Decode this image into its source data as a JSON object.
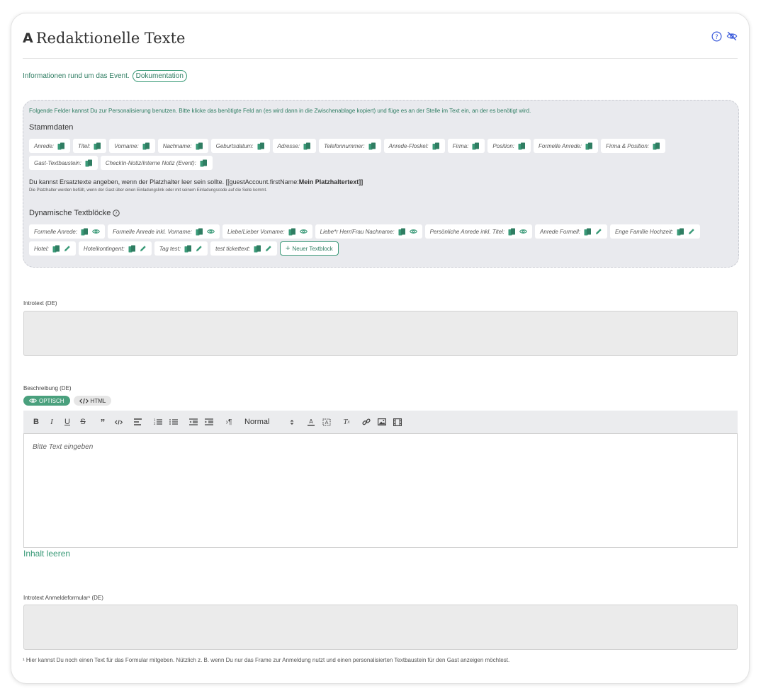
{
  "header": {
    "title": "Redaktionelle Texte",
    "title_glyph": "A"
  },
  "info": {
    "text": "Informationen rund um das Event.",
    "doc_link": "Dokumentation"
  },
  "fields": {
    "intro": "Folgende Felder kannst Du zur Personalisierung benutzen. Bitte klicke das benötigte Feld an (es wird dann in die Zwischenablage kopiert) und füge es an der Stelle im Text ein, an der es benötigt wird.",
    "stammdaten_title": "Stammdaten",
    "stammdaten": [
      "Anrede:",
      "Titel:",
      "Vorname:",
      "Nachname:",
      "Geburtsdatum:",
      "Adresse:",
      "Telefonnummer:",
      "Anrede-Floskel:",
      "Firma:",
      "Position:",
      "Formelle Anrede:",
      "Firma & Position:",
      "Gast-Textbaustein:",
      "CheckIn-Notiz/Interne Notiz (Event):"
    ],
    "ersatz_text": "Du kannst Ersatztexte angeben, wenn der Platzhalter leer sein sollte. [[guestAccount.firstName:",
    "ersatz_bold": "Mein Platzhaltertext",
    "ersatz_end": "]]",
    "ersatz_note": "Die Platzhalter werden befüllt, wenn der Gast über einen Einladungslink oder mit seinem Einladungscode auf die Seite kommt.",
    "dynamic_title": "Dynamische Textblöcke",
    "dynamic": [
      {
        "label": "Formelle Anrede:",
        "action": "eye"
      },
      {
        "label": "Formelle Anrede inkl. Vorname:",
        "action": "eye"
      },
      {
        "label": "Liebe/Lieber Vorname:",
        "action": "eye"
      },
      {
        "label": "Liebe*r Herr/Frau Nachname:",
        "action": "eye"
      },
      {
        "label": "Persönliche Anrede inkl. Titel:",
        "action": "eye"
      },
      {
        "label": "Anrede Formell:",
        "action": "pencil"
      },
      {
        "label": "Enge Familie Hochzeit:",
        "action": "pencil"
      },
      {
        "label": "Hotel:",
        "action": "pencil"
      },
      {
        "label": "Hotelkontingent:",
        "action": "pencil"
      },
      {
        "label": "Tag test:",
        "action": "pencil"
      },
      {
        "label": "test tickettext:",
        "action": "pencil"
      }
    ],
    "new_block": "Neuer Textblock"
  },
  "introtext": {
    "label": "Introtext (DE)",
    "value": ""
  },
  "beschreibung": {
    "label": "Beschreibung (DE)",
    "mode_visual": "OPTISCH",
    "mode_html": "HTML",
    "heading_select": "Normal",
    "placeholder": "Bitte Text eingeben",
    "clear_label": "Inhalt leeren"
  },
  "anmelde": {
    "label": "Introtext Anmeldeformular¹ (DE)",
    "value": ""
  },
  "footnote": "¹ Hier kannst Du noch einen Text für das Formular mitgeben. Nützlich z. B. wenn Du nur das Frame zur Anmeldung nutzt und einen personalisierten Textbaustein für den Gast anzeigen möchtest.",
  "colors": {
    "accent": "#3a9a78",
    "accent_dark": "#2f7d62",
    "icon_blue": "#3b5bdb",
    "panel": "#e9eaee"
  }
}
